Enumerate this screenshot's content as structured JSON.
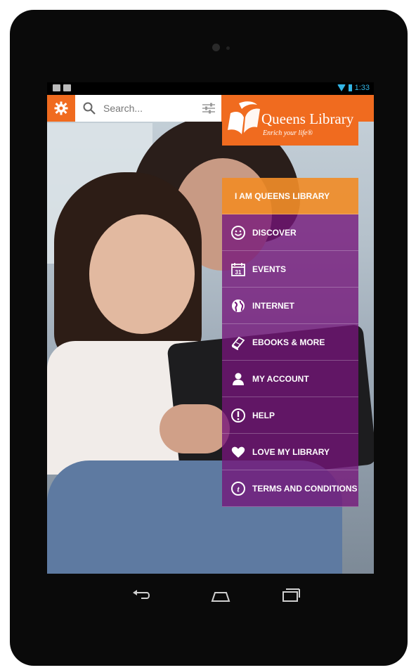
{
  "status_bar": {
    "time": "1:33",
    "icons": [
      "media-icon",
      "checklist-icon",
      "wifi-icon",
      "battery-icon"
    ],
    "accent_color": "#33b5e5"
  },
  "toolbar": {
    "search_placeholder": "Search...",
    "settings_icon": "gear-icon",
    "filter_icon": "sliders-icon",
    "accent_color": "#f06b1f"
  },
  "logo": {
    "title": "Queens Library",
    "tagline": "Enrich your life®"
  },
  "menu": {
    "header_label": "I AM QUEENS LIBRARY",
    "items": [
      {
        "label": "DISCOVER",
        "icon": "smiley-icon"
      },
      {
        "label": "EVENTS",
        "icon": "calendar-icon"
      },
      {
        "label": "INTERNET",
        "icon": "globe-icon"
      },
      {
        "label": "EBOOKS & MORE",
        "icon": "book-icon"
      },
      {
        "label": "MY ACCOUNT",
        "icon": "person-icon"
      },
      {
        "label": "HELP",
        "icon": "exclamation-icon"
      },
      {
        "label": "LOVE MY LIBRARY",
        "icon": "heart-icon"
      },
      {
        "label": "TERMS AND CONDITIONS",
        "icon": "t-circle-icon"
      }
    ],
    "item_color": "#74147a",
    "header_color": "#f08c28"
  },
  "navbar": {
    "icons": [
      "back-icon",
      "home-icon",
      "recent-apps-icon"
    ]
  }
}
